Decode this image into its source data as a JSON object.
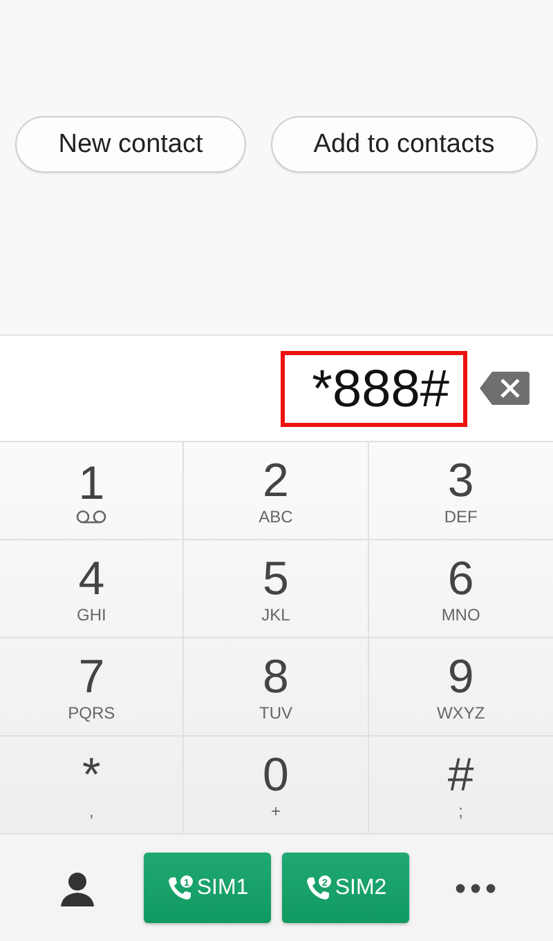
{
  "actions": [
    {
      "label": "New contact"
    },
    {
      "label": "Add to contacts"
    }
  ],
  "number": {
    "value": "*888#",
    "highlighted": true
  },
  "keys": [
    {
      "digit": "1",
      "kind": "voicemail"
    },
    {
      "digit": "2",
      "kind": "letters",
      "sub": "ABC"
    },
    {
      "digit": "3",
      "kind": "letters",
      "sub": "DEF"
    },
    {
      "digit": "4",
      "kind": "letters",
      "sub": "GHI"
    },
    {
      "digit": "5",
      "kind": "letters",
      "sub": "JKL"
    },
    {
      "digit": "6",
      "kind": "letters",
      "sub": "MNO"
    },
    {
      "digit": "7",
      "kind": "letters",
      "sub": "PQRS"
    },
    {
      "digit": "8",
      "kind": "letters",
      "sub": "TUV"
    },
    {
      "digit": "9",
      "kind": "letters",
      "sub": "WXYZ"
    },
    {
      "digit": "*",
      "kind": "letters",
      "sub": ","
    },
    {
      "digit": "0",
      "kind": "letters",
      "sub": "+"
    },
    {
      "digit": "#",
      "kind": "letters",
      "sub": ";"
    }
  ],
  "call_buttons": [
    {
      "label": "SIM1",
      "badge": "1"
    },
    {
      "label": "SIM2",
      "badge": "2"
    }
  ]
}
